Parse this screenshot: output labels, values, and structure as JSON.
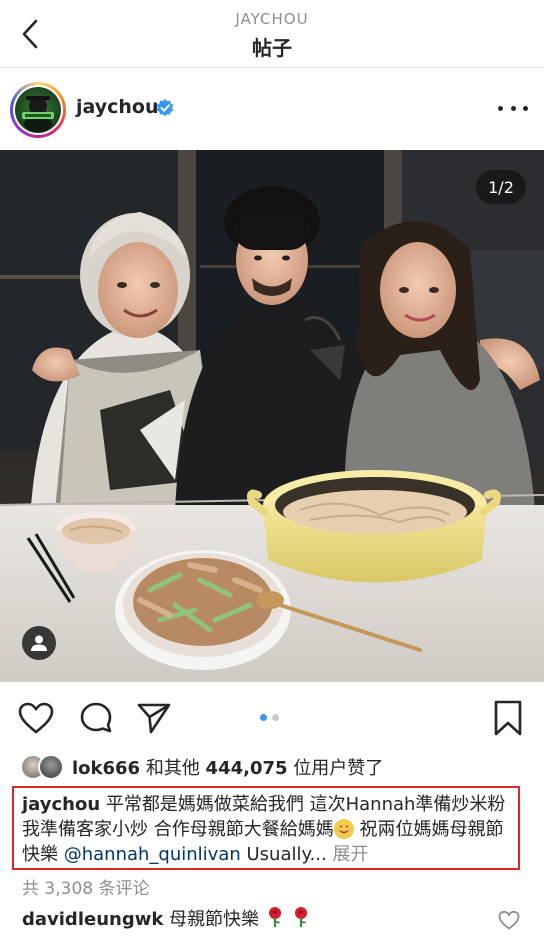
{
  "header": {
    "subtitle": "JAYCHOU",
    "title": "帖子"
  },
  "post": {
    "username": "jaychou",
    "verified": true,
    "image_counter": "1/2",
    "carousel": {
      "count": 2,
      "active": 1
    }
  },
  "likes": {
    "first_user": "lok666",
    "text_mid": " 和其他 ",
    "count": "444,075",
    "text_end": " 位用户赞了"
  },
  "caption": {
    "user": "jaychou",
    "text_part1": " 平常都是媽媽做菜給我們 這次Hannah準備炒米粉 我準備客家小炒 合作母親節大餐給媽媽",
    "emoji": "smiling-face",
    "text_part2": " 祝兩位媽媽母親節快樂 ",
    "mention": "@hannah_quinlivan",
    "text_part3": " Usually...",
    "more_label": " 展开"
  },
  "comments_count_label": "共 3,308 条评论",
  "comment": {
    "user": "davidleungwk",
    "text": " 母親節快樂",
    "emoji": "rose",
    "emoji_count": 2
  },
  "colors": {
    "verified_blue": "#3897f0",
    "highlight_border": "#e0262d",
    "secondary_text": "#8e8e8e",
    "mention_blue": "#003569"
  }
}
